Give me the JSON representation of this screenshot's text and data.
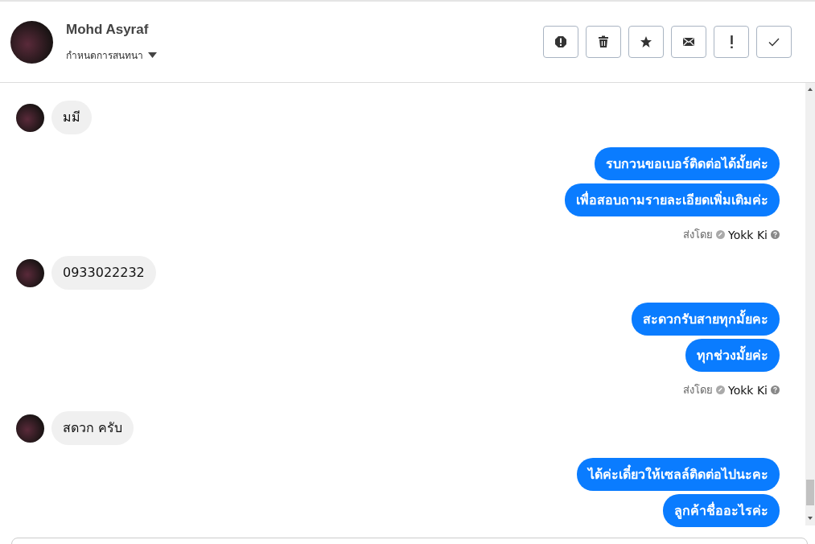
{
  "header": {
    "name": "Mohd Asyraf",
    "menu_label": "กำหนดการสนทนา"
  },
  "conversation": [
    {
      "kind": "incoming",
      "messages": [
        "มมี"
      ]
    },
    {
      "kind": "outgoing",
      "messages": [
        "รบกวนขอเบอร์ติดต่อได้มั้ยค่ะ",
        "เพื่อสอบถามรายละเอียดเพิ่มเติมค่ะ"
      ],
      "sent_by_label": "ส่งโดย",
      "agent": "Yokk Ki"
    },
    {
      "kind": "incoming",
      "messages": [
        "0933022232"
      ]
    },
    {
      "kind": "outgoing",
      "messages": [
        "สะดวกรับสายทุกมั้ยคะ",
        "ทุกช่วงมั้ยค่ะ"
      ],
      "sent_by_label": "ส่งโดย",
      "agent": "Yokk Ki"
    },
    {
      "kind": "incoming",
      "messages": [
        "สดวก ครับ"
      ]
    },
    {
      "kind": "outgoing",
      "messages": [
        "ได้ค่ะเดี๋ยวให้เซลล์ติดต่อไปนะคะ",
        "ลูกค้าชื่ออะไรค่ะ"
      ]
    }
  ]
}
